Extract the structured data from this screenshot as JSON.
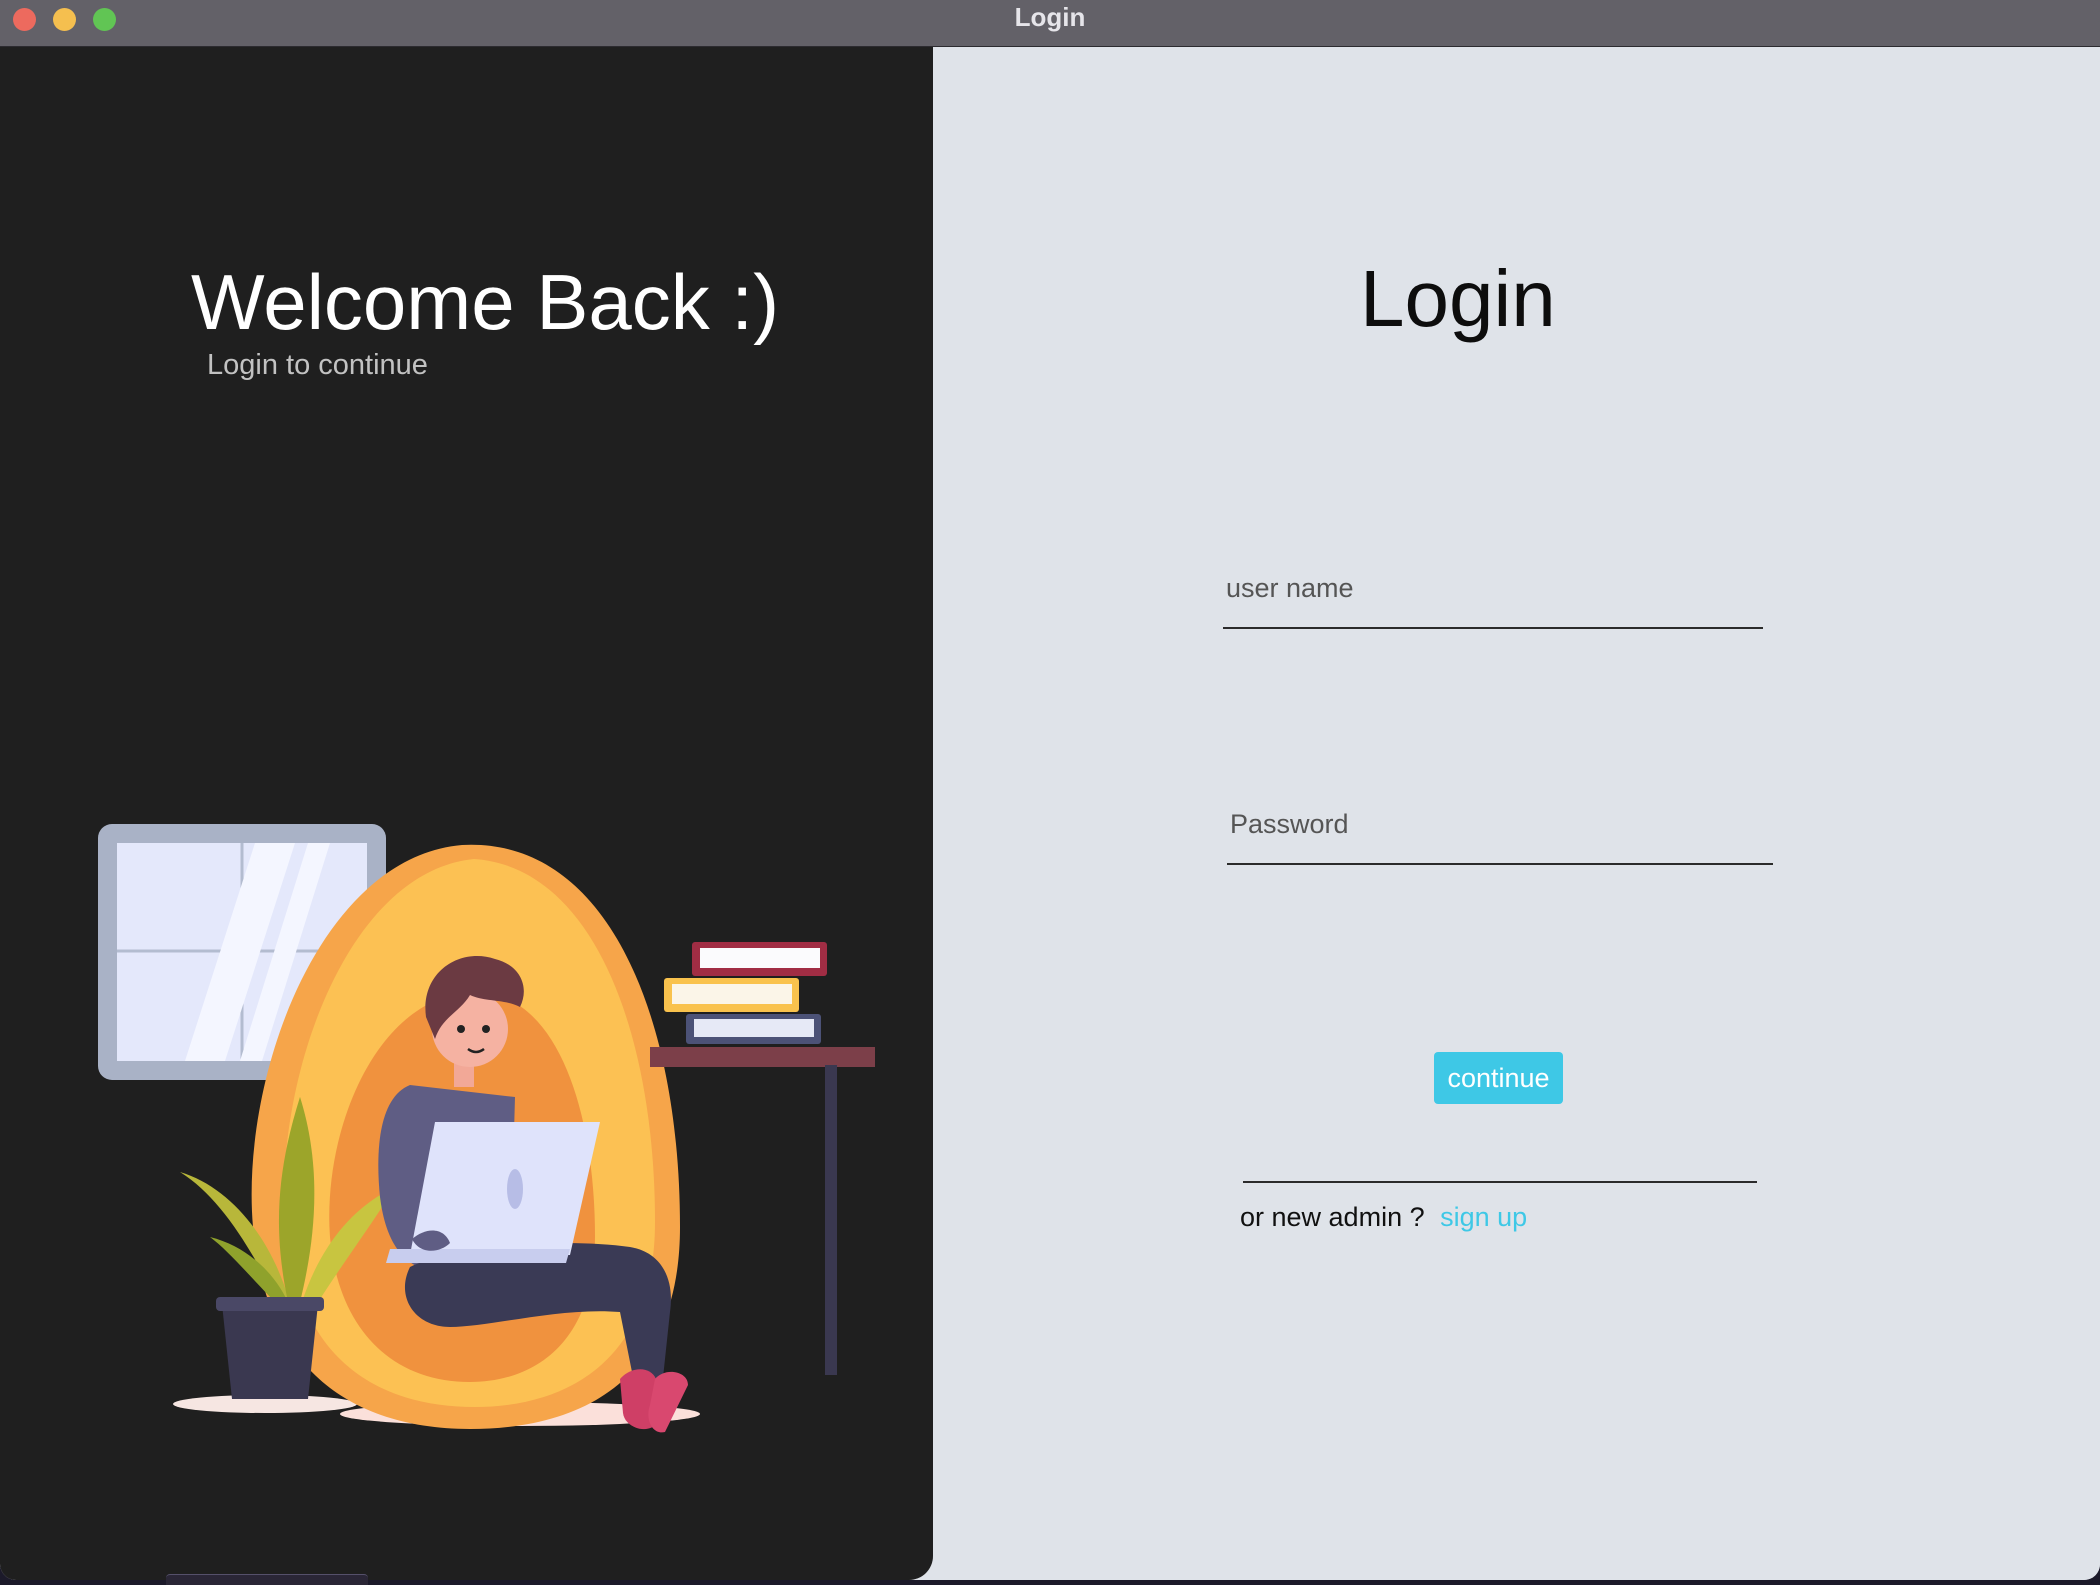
{
  "window": {
    "title": "Login",
    "controls": [
      "close",
      "minimize",
      "zoom"
    ]
  },
  "left_panel": {
    "heading": "Welcome Back :)",
    "subheading": "Login to continue",
    "illustration": "person-with-laptop-in-egg-chair"
  },
  "login_form": {
    "title": "Login",
    "username": {
      "placeholder": "user name",
      "value": ""
    },
    "password": {
      "placeholder": "Password",
      "value": ""
    },
    "continue_label": "continue",
    "signup_prompt": "or new admin ?",
    "signup_link": "sign up"
  },
  "colors": {
    "left_background": "#1f1f1f",
    "right_background": "#dfe3e9",
    "accent": "#3ec8e6",
    "titlebar": "#636168"
  }
}
